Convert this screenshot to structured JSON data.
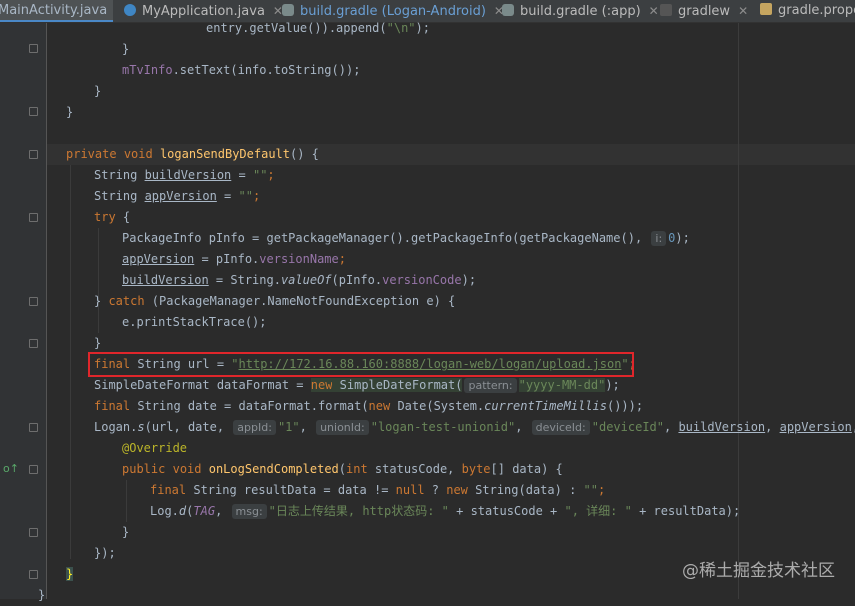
{
  "tabs": [
    {
      "label": "MainActivity.java",
      "active": true,
      "icon": "java-class-icon"
    },
    {
      "label": "MyApplication.java",
      "active": false,
      "icon": "java-class-icon"
    },
    {
      "label": "build.gradle (Logan-Android)",
      "active": false,
      "icon": "gradle-elephant-icon"
    },
    {
      "label": "build.gradle (:app)",
      "active": false,
      "icon": "gradle-elephant-icon"
    },
    {
      "label": "gradlew",
      "active": false,
      "icon": "terminal-script-icon"
    },
    {
      "label": "gradle.proper",
      "active": false,
      "icon": "properties-file-icon"
    }
  ],
  "code": {
    "l1": {
      "a": "entry.getValue()).append(",
      "b": "\"\\n\"",
      "c": ");"
    },
    "l2": "}",
    "l3": {
      "a": "mTvInfo",
      "b": ".setText(info.toString());"
    },
    "l4": "}",
    "l5": "}",
    "l7": {
      "k1": "private",
      "k2": "void",
      "fn": "loganSendByDefault",
      "rest": "() {"
    },
    "l8": {
      "t": "String ",
      "v": "buildVersion",
      "eq": " = ",
      "s": "\"\"",
      "end": ";"
    },
    "l9": {
      "t": "String ",
      "v": "appVersion",
      "eq": " = ",
      "s": "\"\"",
      "end": ";"
    },
    "l10": {
      "k": "try",
      "rest": " {"
    },
    "l11": {
      "a": "PackageInfo pInfo = getPackageManager().getPackageInfo(getPackageName(), ",
      "hint": "i:",
      "num": "0",
      "end": ");"
    },
    "l12": {
      "v": "appVersion",
      "a": " = pInfo.",
      "f": "versionName",
      "end": ";"
    },
    "l13": {
      "v": "buildVersion",
      "a": " = String.",
      "m": "valueOf",
      "b": "(pInfo.",
      "f": "versionCode",
      "end": ");"
    },
    "l14": {
      "a": "} ",
      "k": "catch",
      "b": " (PackageManager.NameNotFoundException e) {"
    },
    "l15": "e.printStackTrace();",
    "l16": "}",
    "l17": {
      "k": "final",
      "a": " String url = ",
      "q1": "\"",
      "url": "http://172.16.88.160:8888/logan-web/logan/upload.json",
      "q2": "\"",
      "end": ";"
    },
    "l18": {
      "a": "SimpleDateFormat dataFormat = ",
      "k": "new",
      "b": " SimpleDateFormat(",
      "hint": "pattern:",
      "s": "\"yyyy-MM-dd\"",
      "end": ");"
    },
    "l19": {
      "k": "final",
      "a": " String date = dataFormat.format(",
      "k2": "new",
      "b": " Date(System.",
      "m": "currentTimeMillis",
      "end": "()));"
    },
    "l20": {
      "a": "Logan.",
      "m": "s",
      "b": "(url, date, ",
      "h1": "appId:",
      "s1": "\"1\"",
      "c": ", ",
      "h2": "unionId:",
      "s2": "\"logan-test-unionid\"",
      "d": ", ",
      "h3": "deviceId:",
      "s3": "\"deviceId\"",
      "e": ", ",
      "v1": "buildVersion",
      "g": ", ",
      "v2": "appVersion",
      "tail": ", n"
    },
    "l21": "@Override",
    "l22": {
      "k1": "public",
      "k2": "void",
      "fn": "onLogSendCompleted",
      "a": "(",
      "k3": "int",
      "b": " statusCode, ",
      "k4": "byte",
      "c": "[] data) {"
    },
    "l23": {
      "k": "final",
      "a": " String resultData = data != ",
      "k2": "null",
      "b": " ? ",
      "k3": "new",
      "c": " String(data) : ",
      "s": "\"\"",
      "end": ";"
    },
    "l24": {
      "a": "Log.",
      "m": "d",
      "b": "(",
      "f": "TAG",
      "c": ", ",
      "hint": "msg:",
      "s1": "\"日志上传结果, http状态码: \"",
      "d": " + statusCode + ",
      "s2": "\", 详细: \"",
      "e": " + resultData);"
    },
    "l25": "}",
    "l26": "});",
    "l27": "}",
    "l28": "}"
  },
  "watermark": "@稀土掘金技术社区"
}
